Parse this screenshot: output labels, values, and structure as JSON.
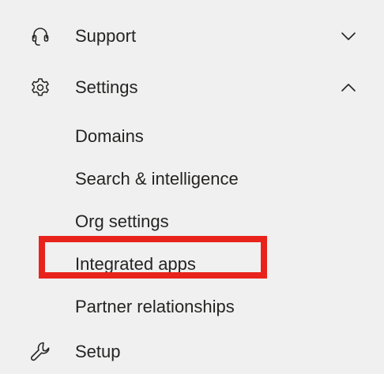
{
  "nav": {
    "support": {
      "label": "Support",
      "icon": "headset-icon",
      "chevron": "chevron-down-icon"
    },
    "settings": {
      "label": "Settings",
      "icon": "gear-icon",
      "chevron": "chevron-up-icon",
      "expanded": true,
      "children": [
        {
          "label": "Domains"
        },
        {
          "label": "Search & intelligence"
        },
        {
          "label": "Org settings"
        },
        {
          "label": "Integrated apps",
          "highlighted": true
        },
        {
          "label": "Partner relationships"
        }
      ]
    },
    "setup": {
      "label": "Setup",
      "icon": "wrench-icon"
    }
  },
  "colors": {
    "background": "#f0f0f0",
    "text": "#252423",
    "highlight_border": "#e8231b"
  }
}
